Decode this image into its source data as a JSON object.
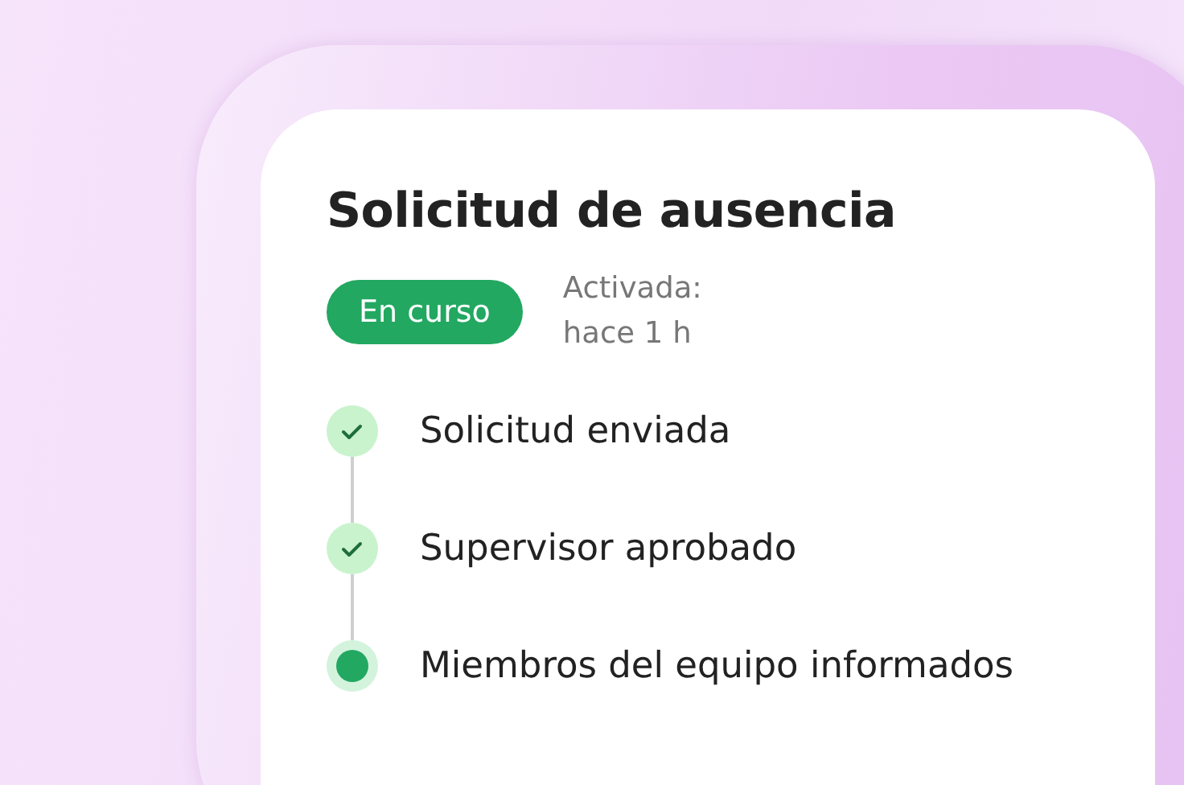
{
  "card": {
    "title": "Solicitud de ausencia",
    "status_badge": "En curso",
    "activated_label": "Activada:",
    "activated_time": "hace 1 h",
    "steps": [
      {
        "label": "Solicitud enviada",
        "completed": true
      },
      {
        "label": "Supervisor aprobado",
        "completed": true
      },
      {
        "label": "Miembros del equipo informados",
        "completed": false
      }
    ]
  }
}
